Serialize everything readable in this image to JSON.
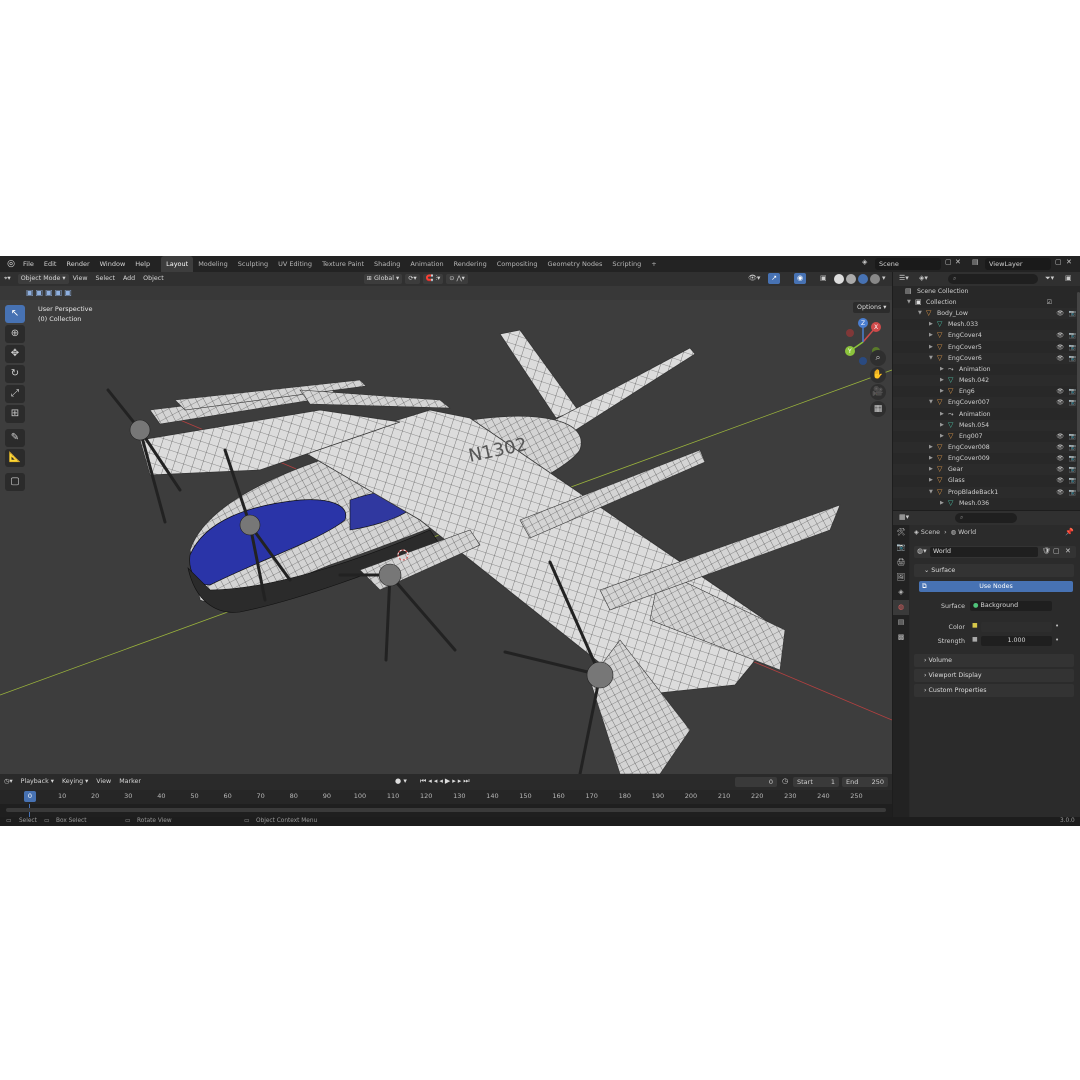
{
  "topbar": {
    "menu": [
      "File",
      "Edit",
      "Render",
      "Window",
      "Help"
    ],
    "workspaces": [
      "Layout",
      "Modeling",
      "Sculpting",
      "UV Editing",
      "Texture Paint",
      "Shading",
      "Animation",
      "Rendering",
      "Compositing",
      "Geometry Nodes",
      "Scripting"
    ],
    "active_workspace": "Layout",
    "add_tab": "+",
    "scene_name": "Scene",
    "view_layer": "ViewLayer"
  },
  "viewport": {
    "mode": "Object Mode",
    "menu": [
      "View",
      "Select",
      "Add",
      "Object"
    ],
    "orientation": "Global",
    "options_label": "Options",
    "perspective_label": "User Perspective",
    "collection_label": "(0) Collection",
    "gizmo_axes": [
      "X",
      "Y",
      "Z"
    ],
    "aircraft_reg": "N1302"
  },
  "outliner": {
    "title": "Scene Collection",
    "rows": [
      {
        "name": "Collection",
        "icon": "collection-icon",
        "indent": 0
      },
      {
        "name": "Body_Low",
        "icon": "tri-o",
        "indent": 1
      },
      {
        "name": "Mesh.033",
        "icon": "tri-g",
        "indent": 2
      },
      {
        "name": "EngCover4",
        "icon": "tri-o",
        "indent": 2
      },
      {
        "name": "EngCover5",
        "icon": "tri-o",
        "indent": 2
      },
      {
        "name": "EngCover6",
        "icon": "tri-o",
        "indent": 2
      },
      {
        "name": "Animation",
        "icon": "action-icon",
        "indent": 3
      },
      {
        "name": "Mesh.042",
        "icon": "tri-g",
        "indent": 3
      },
      {
        "name": "Eng6",
        "icon": "tri-o",
        "indent": 3
      },
      {
        "name": "EngCover007",
        "icon": "tri-o",
        "indent": 2
      },
      {
        "name": "Animation",
        "icon": "action-icon",
        "indent": 3
      },
      {
        "name": "Mesh.054",
        "icon": "tri-g",
        "indent": 3
      },
      {
        "name": "Eng007",
        "icon": "tri-o",
        "indent": 3
      },
      {
        "name": "EngCover008",
        "icon": "tri-o",
        "indent": 2
      },
      {
        "name": "EngCover009",
        "icon": "tri-o",
        "indent": 2
      },
      {
        "name": "Gear",
        "icon": "tri-o",
        "indent": 2
      },
      {
        "name": "Glass",
        "icon": "tri-o",
        "indent": 2
      },
      {
        "name": "PropBladeBack1",
        "icon": "tri-o",
        "indent": 2
      },
      {
        "name": "Mesh.036",
        "icon": "tri-g",
        "indent": 3
      }
    ]
  },
  "properties": {
    "breadcrumb_scene": "Scene",
    "breadcrumb_world": "World",
    "world_name": "World",
    "surface_panel": "Surface",
    "use_nodes": "Use Nodes",
    "surface_label": "Surface",
    "surface_value": "Background",
    "color_label": "Color",
    "strength_label": "Strength",
    "strength_value": "1.000",
    "collapsed_panels": [
      "Volume",
      "Viewport Display",
      "Custom Properties"
    ]
  },
  "timeline": {
    "menu": [
      "Playback",
      "Keying",
      "View",
      "Marker"
    ],
    "current_frame": "0",
    "start_label": "Start",
    "start_value": "1",
    "end_label": "End",
    "end_value": "250",
    "ruler": [
      0,
      10,
      20,
      30,
      40,
      50,
      60,
      70,
      80,
      90,
      100,
      110,
      120,
      130,
      140,
      150,
      160,
      170,
      180,
      190,
      200,
      210,
      220,
      230,
      240,
      250
    ]
  },
  "statusbar": {
    "select": "Select",
    "box_select": "Box Select",
    "rotate_view": "Rotate View",
    "context_menu": "Object Context Menu",
    "version": "3.0.0"
  },
  "colors": {
    "accent": "#4772b3",
    "x_axis": "#d04a4a",
    "y_axis": "#8cc43c",
    "z_axis": "#4a7ed0"
  }
}
